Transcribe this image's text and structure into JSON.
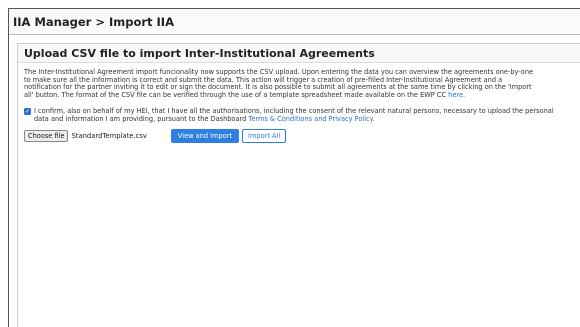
{
  "breadcrumb": "IIA Manager > Import IIA",
  "panel": {
    "title": "Upload CSV file to import Inter-Institutional Agreements",
    "intro_text": "The Inter-Institutional Agreement import funcionality now supports the CSV upload. Upon entering the data you can overview the agreements one-by-one\nto make sure all the information is correct and submit the data. This action will trigger a creation of pre-filled Inter-Institutional Agreement and a\nnotification for the partner inviting it to edit or sign the document. It is also possible to submit all agreements at the same time by clicking on the 'Import\nall' button. The format of the CSV file can be verified through the use of a template spreadsheet made available on the EWP CC",
    "intro_link": "here.",
    "confirm_text": "I confirm, also on behalf of my HEI, that I have all the authorisations, including the consent of the relevant natural persons, necessary to upload the personal\ndata and information I am providing, pursuant to the Dashboard",
    "confirm_link": "Terms & Conditions and Privacy Policy.",
    "confirm_checked": true
  },
  "actions": {
    "choose_file_label": "Choose file",
    "file_name": "StandardTemplate.csv",
    "view_import_label": "View and Import",
    "import_all_label": "Import All"
  },
  "colors": {
    "accent": "#2f7fe0",
    "link": "#2a6fc9"
  }
}
